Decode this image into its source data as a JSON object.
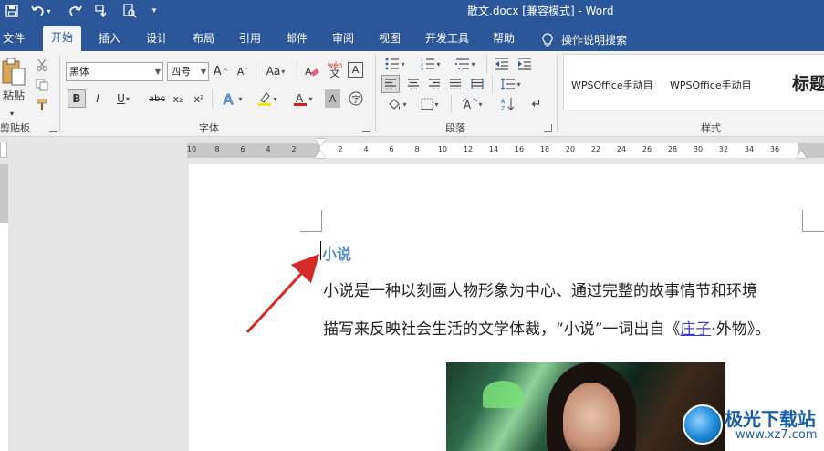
{
  "titlebar": {
    "title": "散文.docx [兼容模式] - Word",
    "bg_color": "#2b579a"
  },
  "tabs": [
    {
      "label": "文件"
    },
    {
      "label": "开始",
      "active": true
    },
    {
      "label": "插入"
    },
    {
      "label": "设计"
    },
    {
      "label": "布局"
    },
    {
      "label": "引用"
    },
    {
      "label": "邮件"
    },
    {
      "label": "审阅"
    },
    {
      "label": "视图"
    },
    {
      "label": "开发工具"
    },
    {
      "label": "帮助"
    },
    {
      "label": "操作说明搜索"
    }
  ],
  "ribbon": {
    "clipboard": {
      "paste_label": "粘贴",
      "group_label": "剪贴板"
    },
    "font": {
      "font_name": "黑体",
      "font_size": "四号",
      "group_label": "字体",
      "bold": "B",
      "italic": "I",
      "underline": "U",
      "strike": "abc",
      "subscript": "x₂",
      "superscript": "x²",
      "grow": "A",
      "shrink": "A",
      "case": "Aa",
      "phonetic": "wén",
      "phonetic_sub": "文"
    },
    "paragraph": {
      "group_label": "段落"
    },
    "styles": {
      "group_label": "样式",
      "items": [
        "WPSOffice手动目",
        "WPSOffice手动目",
        "标题"
      ]
    }
  },
  "ruler": {
    "marks": [
      "10",
      "8",
      "6",
      "4",
      "2",
      "2",
      "4",
      "6",
      "8",
      "10",
      "12",
      "14",
      "16",
      "18",
      "20",
      "22",
      "24",
      "26",
      "28",
      "30",
      "32",
      "34",
      "36"
    ]
  },
  "document": {
    "heading": "小说",
    "line1": "小说是一种以刻画人物形象为中心、通过完整的故事情节和环境",
    "line2_prefix": "描写来反映社会生活的文学体裁，“小说”一词出自《",
    "line2_link": "庄子",
    "line2_suffix": "·外物》。",
    "heading_color": "#4e8ccb",
    "link_color": "#3b3bd0"
  },
  "watermark": {
    "title": "极光下载站",
    "url": "www.xz7.com"
  },
  "annotation": {
    "arrow_color": "#d42a2a"
  }
}
